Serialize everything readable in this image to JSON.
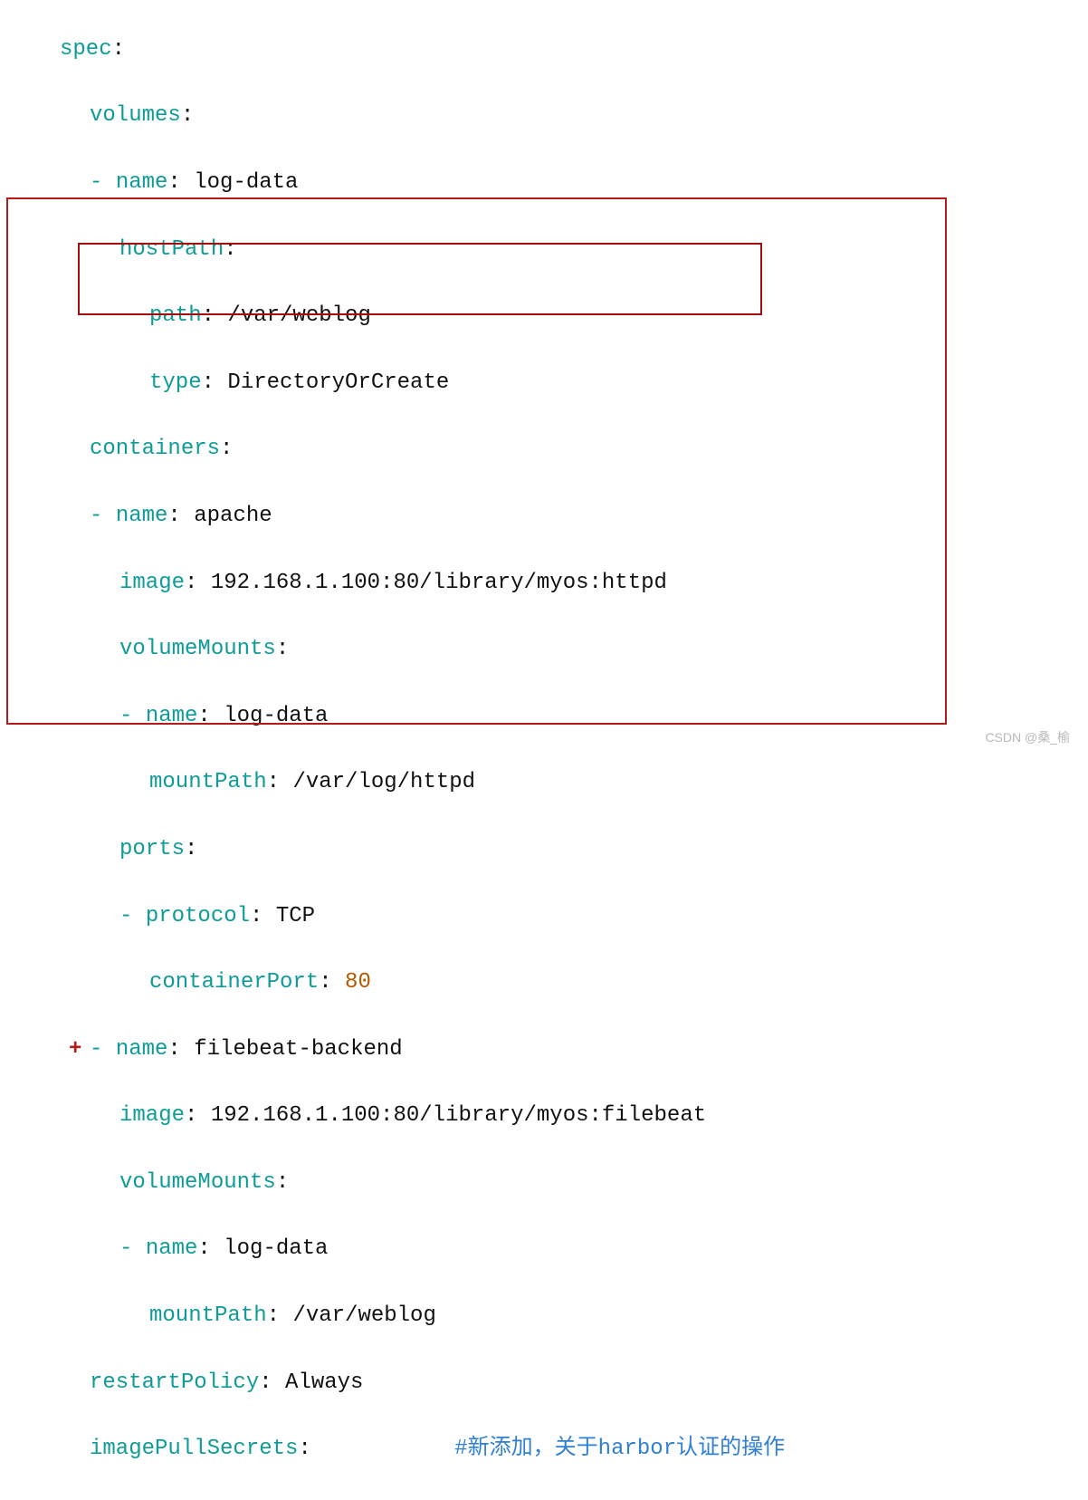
{
  "code": {
    "l1_key": "spec",
    "l2_key": "volumes",
    "l3_dash": "-",
    "l3_key": "name",
    "l3_val": "log-data",
    "l4_key": "hostPath",
    "l5_key": "path",
    "l5_val": "/var/weblog",
    "l6_key": "type",
    "l6_val": "DirectoryOrCreate",
    "l7_key": "containers",
    "l8_dash": "-",
    "l8_key": "name",
    "l8_val": "apache",
    "l9_key": "image",
    "l9_val": "192.168.1.100:80/library/myos:httpd",
    "l10_key": "volumeMounts",
    "l11_dash": "-",
    "l11_key": "name",
    "l11_val": "log-data",
    "l12_key": "mountPath",
    "l12_val": "/var/log/httpd",
    "l13_key": "ports",
    "l14_dash": "-",
    "l14_key": "protocol",
    "l14_val": "TCP",
    "l15_key": "containerPort",
    "l15_val": "80",
    "l16_plus": "+",
    "l16_dash": "-",
    "l16_key": "name",
    "l16_val": "filebeat-backend",
    "l17_key": "image",
    "l17_val": "192.168.1.100:80/library/myos:filebeat",
    "l18_key": "volumeMounts",
    "l19_dash": "-",
    "l19_key": "name",
    "l19_val": "log-data",
    "l20_key": "mountPath",
    "l20_val": "/var/weblog",
    "l21_key": "restartPolicy",
    "l21_val": "Always",
    "l22_key": "imagePullSecrets",
    "l22_comment": "#新添加，关于harbor认证的操作"
  },
  "watermark": "CSDN @桑_榆"
}
